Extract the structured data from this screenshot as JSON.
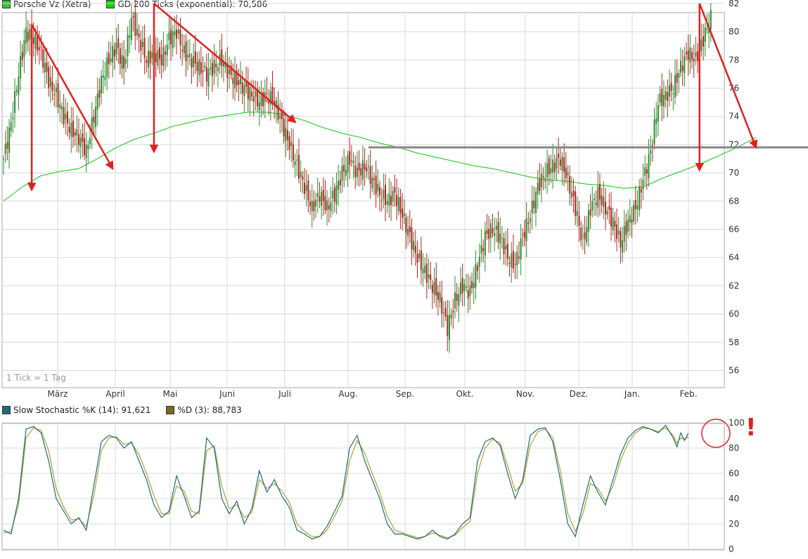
{
  "top_legend": {
    "item1": {
      "label": "Porsche Vz (Xetra)",
      "color": "#33cc33"
    },
    "item2": {
      "label": "GD 200 Ticks (exponential): 70,586",
      "color": "#00dd00"
    }
  },
  "bottom_legend": {
    "item1": {
      "label": "Slow Stochastic %K (14): 91,621",
      "color": "#1c6c7c"
    },
    "item2": {
      "label": "%D (3): 88,783",
      "color": "#7a6a1a"
    }
  },
  "tick_note": "1 Tick = 1 Tag",
  "annotation_mark": "!",
  "colors": {
    "up_candle": "#2e8b2e",
    "down_candle": "#b22222",
    "ema": "#33cc33",
    "annotation": "#e02020",
    "resistance": "#888888",
    "grid": "#d8d8d8",
    "stoch_k": "#1c6c7c",
    "stoch_d": "#b0a030"
  },
  "chart_data": [
    {
      "type": "candlestick",
      "series_name": "Porsche Vz (Xetra)",
      "x_labels": [
        "März",
        "April",
        "Mai",
        "Juni",
        "Juli",
        "Aug.",
        "Sep.",
        "Okt.",
        "Nov.",
        "Dez.",
        "Jan.",
        "Feb."
      ],
      "y_ticks": [
        56,
        58,
        60,
        62,
        64,
        66,
        68,
        70,
        72,
        74,
        76,
        78,
        80,
        82
      ],
      "ylim": [
        55,
        83
      ],
      "overlay": {
        "name": "GD 200 Ticks (exponential)",
        "last_value": 70.586
      },
      "close_anchors": [
        [
          0,
          71
        ],
        [
          4,
          73.5
        ],
        [
          8,
          77
        ],
        [
          12,
          80
        ],
        [
          16,
          79.5
        ],
        [
          20,
          78.5
        ],
        [
          24,
          76.5
        ],
        [
          28,
          75.5
        ],
        [
          32,
          74
        ],
        [
          36,
          73
        ],
        [
          40,
          72.5
        ],
        [
          44,
          71.5
        ],
        [
          48,
          74
        ],
        [
          52,
          76.5
        ],
        [
          56,
          78
        ],
        [
          60,
          79
        ],
        [
          64,
          77.5
        ],
        [
          68,
          81
        ],
        [
          72,
          79.5
        ],
        [
          76,
          78
        ],
        [
          80,
          78.5
        ],
        [
          84,
          78
        ],
        [
          88,
          79.5
        ],
        [
          92,
          80
        ],
        [
          96,
          78.5
        ],
        [
          100,
          78
        ],
        [
          104,
          77.5
        ],
        [
          108,
          77
        ],
        [
          112,
          77.5
        ],
        [
          116,
          78
        ],
        [
          120,
          77
        ],
        [
          124,
          76.5
        ],
        [
          128,
          76
        ],
        [
          132,
          75.5
        ],
        [
          136,
          75
        ],
        [
          140,
          75.5
        ],
        [
          144,
          75
        ],
        [
          148,
          73.5
        ],
        [
          152,
          72
        ],
        [
          156,
          70.5
        ],
        [
          160,
          69
        ],
        [
          164,
          67.5
        ],
        [
          168,
          68.5
        ],
        [
          172,
          67.5
        ],
        [
          176,
          68.5
        ],
        [
          180,
          70
        ],
        [
          184,
          71
        ],
        [
          188,
          70
        ],
        [
          192,
          70.5
        ],
        [
          196,
          69.5
        ],
        [
          200,
          68.5
        ],
        [
          204,
          68
        ],
        [
          208,
          68.5
        ],
        [
          212,
          67
        ],
        [
          216,
          65.5
        ],
        [
          220,
          64
        ],
        [
          224,
          63
        ],
        [
          228,
          62
        ],
        [
          232,
          61
        ],
        [
          236,
          59
        ],
        [
          240,
          61
        ],
        [
          244,
          62
        ],
        [
          248,
          61.5
        ],
        [
          252,
          63.5
        ],
        [
          256,
          65.5
        ],
        [
          260,
          66
        ],
        [
          264,
          65.5
        ],
        [
          268,
          64
        ],
        [
          272,
          63.5
        ],
        [
          276,
          65.5
        ],
        [
          280,
          67
        ],
        [
          284,
          69
        ],
        [
          288,
          70
        ],
        [
          292,
          70.5
        ],
        [
          296,
          71
        ],
        [
          300,
          69.5
        ],
        [
          304,
          67.5
        ],
        [
          308,
          65
        ],
        [
          312,
          67.5
        ],
        [
          316,
          68.5
        ],
        [
          320,
          67.5
        ],
        [
          324,
          66.5
        ],
        [
          328,
          65
        ],
        [
          332,
          66.5
        ],
        [
          336,
          67.5
        ],
        [
          340,
          69.5
        ],
        [
          344,
          71.5
        ],
        [
          348,
          75
        ],
        [
          352,
          75.5
        ],
        [
          356,
          76
        ],
        [
          360,
          77.5
        ],
        [
          364,
          78.5
        ],
        [
          368,
          78
        ],
        [
          372,
          79.5
        ],
        [
          376,
          81
        ]
      ],
      "ema_anchors": [
        [
          0,
          68
        ],
        [
          10,
          69
        ],
        [
          20,
          69.8
        ],
        [
          30,
          70.1
        ],
        [
          40,
          70.3
        ],
        [
          50,
          71
        ],
        [
          60,
          71.8
        ],
        [
          70,
          72.4
        ],
        [
          80,
          72.8
        ],
        [
          90,
          73.3
        ],
        [
          100,
          73.6
        ],
        [
          110,
          73.9
        ],
        [
          120,
          74.1
        ],
        [
          130,
          74.3
        ],
        [
          140,
          74.3
        ],
        [
          150,
          74.1
        ],
        [
          160,
          73.7
        ],
        [
          170,
          73.2
        ],
        [
          180,
          72.8
        ],
        [
          190,
          72.5
        ],
        [
          200,
          72.1
        ],
        [
          210,
          71.8
        ],
        [
          220,
          71.4
        ],
        [
          230,
          71.1
        ],
        [
          240,
          70.8
        ],
        [
          250,
          70.5
        ],
        [
          260,
          70.3
        ],
        [
          270,
          70
        ],
        [
          280,
          69.7
        ],
        [
          290,
          69.5
        ],
        [
          300,
          69.4
        ],
        [
          310,
          69.2
        ],
        [
          320,
          69.1
        ],
        [
          330,
          68.9
        ],
        [
          340,
          69
        ],
        [
          350,
          69.6
        ],
        [
          360,
          70.1
        ],
        [
          370,
          70.6
        ],
        [
          380,
          71.2
        ],
        [
          390,
          71.8
        ],
        [
          400,
          72.5
        ]
      ],
      "resistance_level": 71.8,
      "annotation_arrows": [
        {
          "from": [
            15,
            80.5
          ],
          "to": [
            15,
            68.8
          ]
        },
        {
          "from": [
            15,
            80.5
          ],
          "to": [
            58,
            70.3
          ]
        },
        {
          "from": [
            80,
            82
          ],
          "to": [
            80,
            71.5
          ]
        },
        {
          "from": [
            80,
            82
          ],
          "to": [
            155,
            73.6
          ]
        },
        {
          "from": [
            370,
            82
          ],
          "to": [
            370,
            70.2
          ]
        },
        {
          "from": [
            370,
            82
          ],
          "to": [
            400,
            71.8
          ]
        }
      ]
    },
    {
      "type": "line",
      "x_labels": [],
      "y_ticks": [
        0,
        20,
        40,
        60,
        80,
        100
      ],
      "ylim": [
        0,
        100
      ],
      "series": [
        {
          "name": "Slow Stochastic %K (14)",
          "last_value": 91.621
        },
        {
          "name": "%D (3)",
          "last_value": 88.783
        }
      ],
      "k_anchors": [
        [
          0,
          15
        ],
        [
          4,
          12
        ],
        [
          8,
          40
        ],
        [
          12,
          95
        ],
        [
          16,
          97
        ],
        [
          20,
          92
        ],
        [
          24,
          70
        ],
        [
          28,
          40
        ],
        [
          32,
          30
        ],
        [
          36,
          20
        ],
        [
          40,
          25
        ],
        [
          44,
          15
        ],
        [
          48,
          50
        ],
        [
          52,
          85
        ],
        [
          56,
          90
        ],
        [
          60,
          88
        ],
        [
          64,
          80
        ],
        [
          68,
          85
        ],
        [
          72,
          70
        ],
        [
          76,
          55
        ],
        [
          80,
          35
        ],
        [
          84,
          25
        ],
        [
          88,
          30
        ],
        [
          92,
          58
        ],
        [
          96,
          42
        ],
        [
          100,
          25
        ],
        [
          104,
          30
        ],
        [
          108,
          88
        ],
        [
          112,
          80
        ],
        [
          116,
          40
        ],
        [
          120,
          28
        ],
        [
          124,
          38
        ],
        [
          128,
          20
        ],
        [
          132,
          32
        ],
        [
          136,
          62
        ],
        [
          140,
          45
        ],
        [
          144,
          55
        ],
        [
          148,
          42
        ],
        [
          152,
          33
        ],
        [
          156,
          15
        ],
        [
          160,
          12
        ],
        [
          164,
          8
        ],
        [
          168,
          10
        ],
        [
          172,
          18
        ],
        [
          176,
          30
        ],
        [
          180,
          42
        ],
        [
          184,
          80
        ],
        [
          188,
          90
        ],
        [
          192,
          70
        ],
        [
          196,
          55
        ],
        [
          200,
          40
        ],
        [
          204,
          20
        ],
        [
          208,
          12
        ],
        [
          212,
          12
        ],
        [
          216,
          10
        ],
        [
          220,
          8
        ],
        [
          224,
          10
        ],
        [
          228,
          15
        ],
        [
          232,
          10
        ],
        [
          236,
          8
        ],
        [
          240,
          12
        ],
        [
          244,
          20
        ],
        [
          248,
          25
        ],
        [
          252,
          70
        ],
        [
          256,
          85
        ],
        [
          260,
          88
        ],
        [
          264,
          82
        ],
        [
          268,
          60
        ],
        [
          272,
          40
        ],
        [
          276,
          55
        ],
        [
          280,
          90
        ],
        [
          284,
          95
        ],
        [
          288,
          96
        ],
        [
          292,
          85
        ],
        [
          296,
          55
        ],
        [
          300,
          20
        ],
        [
          304,
          10
        ],
        [
          308,
          35
        ],
        [
          312,
          58
        ],
        [
          316,
          45
        ],
        [
          320,
          35
        ],
        [
          324,
          55
        ],
        [
          328,
          75
        ],
        [
          332,
          88
        ],
        [
          336,
          94
        ],
        [
          340,
          97
        ],
        [
          344,
          95
        ],
        [
          348,
          92
        ],
        [
          352,
          98
        ],
        [
          356,
          88
        ],
        [
          358,
          81
        ],
        [
          360,
          92
        ],
        [
          362,
          86
        ],
        [
          364,
          91.6
        ]
      ],
      "d_anchors": [
        [
          0,
          13
        ],
        [
          4,
          14
        ],
        [
          8,
          35
        ],
        [
          12,
          88
        ],
        [
          16,
          96
        ],
        [
          20,
          94
        ],
        [
          24,
          78
        ],
        [
          28,
          48
        ],
        [
          32,
          33
        ],
        [
          36,
          23
        ],
        [
          40,
          24
        ],
        [
          44,
          18
        ],
        [
          48,
          42
        ],
        [
          52,
          78
        ],
        [
          56,
          88
        ],
        [
          60,
          89
        ],
        [
          64,
          83
        ],
        [
          68,
          84
        ],
        [
          72,
          75
        ],
        [
          76,
          60
        ],
        [
          80,
          42
        ],
        [
          84,
          28
        ],
        [
          88,
          28
        ],
        [
          92,
          50
        ],
        [
          96,
          46
        ],
        [
          100,
          30
        ],
        [
          104,
          28
        ],
        [
          108,
          78
        ],
        [
          112,
          82
        ],
        [
          116,
          50
        ],
        [
          120,
          32
        ],
        [
          124,
          35
        ],
        [
          128,
          25
        ],
        [
          132,
          29
        ],
        [
          136,
          55
        ],
        [
          140,
          48
        ],
        [
          144,
          52
        ],
        [
          148,
          46
        ],
        [
          152,
          37
        ],
        [
          156,
          20
        ],
        [
          160,
          14
        ],
        [
          164,
          10
        ],
        [
          168,
          10
        ],
        [
          172,
          15
        ],
        [
          176,
          26
        ],
        [
          180,
          38
        ],
        [
          184,
          70
        ],
        [
          188,
          86
        ],
        [
          192,
          76
        ],
        [
          196,
          60
        ],
        [
          200,
          45
        ],
        [
          204,
          26
        ],
        [
          208,
          15
        ],
        [
          212,
          13
        ],
        [
          216,
          11
        ],
        [
          220,
          9
        ],
        [
          224,
          10
        ],
        [
          228,
          13
        ],
        [
          232,
          11
        ],
        [
          236,
          9
        ],
        [
          240,
          11
        ],
        [
          244,
          17
        ],
        [
          248,
          22
        ],
        [
          252,
          60
        ],
        [
          256,
          80
        ],
        [
          260,
          87
        ],
        [
          264,
          84
        ],
        [
          268,
          66
        ],
        [
          272,
          46
        ],
        [
          276,
          52
        ],
        [
          280,
          82
        ],
        [
          284,
          93
        ],
        [
          288,
          95
        ],
        [
          292,
          88
        ],
        [
          296,
          62
        ],
        [
          300,
          28
        ],
        [
          304,
          14
        ],
        [
          308,
          28
        ],
        [
          312,
          52
        ],
        [
          316,
          48
        ],
        [
          320,
          38
        ],
        [
          324,
          50
        ],
        [
          328,
          70
        ],
        [
          332,
          84
        ],
        [
          336,
          92
        ],
        [
          340,
          96
        ],
        [
          344,
          95
        ],
        [
          348,
          93
        ],
        [
          352,
          96
        ],
        [
          356,
          90
        ],
        [
          358,
          84
        ],
        [
          360,
          88
        ],
        [
          362,
          87
        ],
        [
          364,
          88.8
        ]
      ]
    }
  ]
}
